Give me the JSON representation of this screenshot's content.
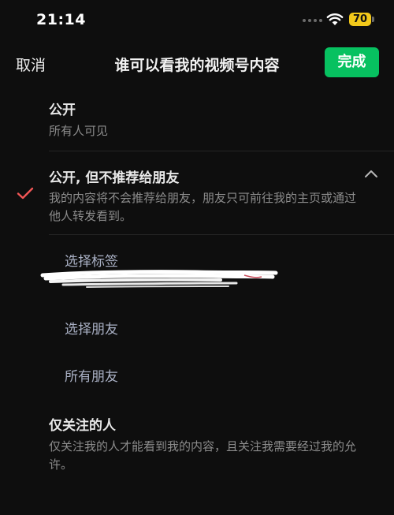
{
  "status_bar": {
    "time": "21:14",
    "battery": "70"
  },
  "nav": {
    "cancel_label": "取消",
    "title": "谁可以看我的视频号内容",
    "done_label": "完成"
  },
  "options": [
    {
      "title": "公开",
      "desc": "所有人可见",
      "selected": false
    },
    {
      "title": "公开, 但不推荐给朋友",
      "desc": "我的内容将不会推荐给朋友，朋友只可前往我的主页或通过他人转发看到。",
      "selected": true,
      "expanded": true
    },
    {
      "title": "仅关注的人",
      "desc": "仅关注我的人才能看到我的内容，且关注我需要经过我的允许。",
      "selected": false
    }
  ],
  "sub_options": [
    "选择标签",
    "选择朋友",
    "所有朋友"
  ],
  "colors": {
    "accent_green": "#07c160",
    "check_red": "#f25656",
    "battery_yellow": "#f2c81a"
  },
  "icons": [
    "wifi-icon",
    "check-icon",
    "chevron-up-icon"
  ]
}
